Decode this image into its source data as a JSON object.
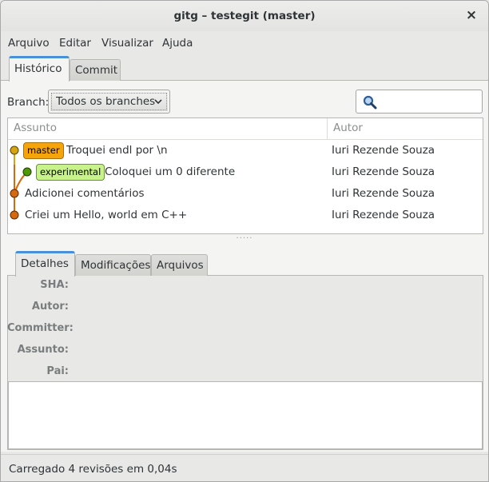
{
  "window": {
    "title": "gitg – testegit (master)"
  },
  "menu": [
    "Arquivo",
    "Editar",
    "Visualizar",
    "Ajuda"
  ],
  "main_tabs": [
    "Histórico",
    "Commit"
  ],
  "branch": {
    "label": "Branch:",
    "selected": "Todos os branches"
  },
  "search": {
    "value": "",
    "placeholder": ""
  },
  "history": {
    "columns": [
      "Assunto",
      "Autor"
    ],
    "rows": [
      {
        "ref": "master",
        "subject": "Troquei endl por \\n",
        "author": "Iuri Rezende Souza"
      },
      {
        "ref": "experimental",
        "subject": "Coloquei um 0 diferente",
        "author": "Iuri Rezende Souza"
      },
      {
        "ref": "",
        "subject": "Adicionei comentários",
        "author": "Iuri Rezende Souza"
      },
      {
        "ref": "",
        "subject": "Criei um Hello, world em C++",
        "author": "Iuri Rezende Souza"
      }
    ]
  },
  "detail_tabs": [
    "Detalhes",
    "Modificações",
    "Arquivos"
  ],
  "details": {
    "labels": [
      "SHA:",
      "Autor:",
      "Committer:",
      "Assunto:",
      "Pai:"
    ]
  },
  "status": "Carregado 4 revisões em 0,04s",
  "colors": {
    "accent": "#4a90d9",
    "master_ref": "#f5a50a",
    "experimental_ref": "#c8f28a",
    "graph_orange": "#d4690f",
    "graph_green": "#4e9a06",
    "graph_yellow": "#d6a412"
  },
  "icons": {
    "search": "search-icon",
    "close": "close-icon",
    "dropdown": "chevron-down-icon"
  }
}
